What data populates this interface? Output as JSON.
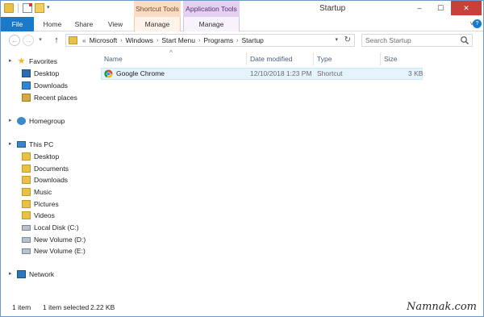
{
  "window": {
    "title": "Startup",
    "controls": {
      "minimize": "–",
      "maximize": "☐",
      "close": "✕"
    }
  },
  "quick_access": {
    "dropdown": "▾"
  },
  "tool_tab_headers": {
    "shortcut_tools": "Shortcut Tools",
    "application_tools": "Application Tools"
  },
  "ribbon": {
    "tabs": [
      {
        "label": "File"
      },
      {
        "label": "Home"
      },
      {
        "label": "Share"
      },
      {
        "label": "View"
      },
      {
        "label": "Manage"
      },
      {
        "label": "Manage"
      }
    ],
    "expand": "˅",
    "help": "?"
  },
  "address_bar": {
    "back": "←",
    "forward": "→",
    "recent": "▾",
    "up": "↑",
    "overflow": "«",
    "breadcrumbs": [
      "Microsoft",
      "Windows",
      "Start Menu",
      "Programs",
      "Startup"
    ],
    "separator": "›",
    "dropdown": "▾",
    "refresh": "↻"
  },
  "search": {
    "placeholder": "Search Startup"
  },
  "nav_pane": {
    "favorites": {
      "label": "Favorites",
      "items": [
        "Desktop",
        "Downloads",
        "Recent places"
      ]
    },
    "homegroup": {
      "label": "Homegroup"
    },
    "this_pc": {
      "label": "This PC",
      "items": [
        "Desktop",
        "Documents",
        "Downloads",
        "Music",
        "Pictures",
        "Videos",
        "Local Disk (C:)",
        "New Volume (D:)",
        "New Volume (E:)"
      ]
    },
    "network": {
      "label": "Network"
    },
    "expander": "▸"
  },
  "file_list": {
    "sort_indicator": "^",
    "columns": [
      "Name",
      "Date modified",
      "Type",
      "Size"
    ],
    "rows": [
      {
        "name": "Google Chrome",
        "date_modified": "12/10/2018 1:23 PM",
        "type": "Shortcut",
        "size": "3 KB"
      }
    ]
  },
  "status_bar": {
    "item_count": "1 item",
    "selection": "1 item selected",
    "selection_size": "2.22 KB"
  },
  "watermark": "Namnak.com"
}
